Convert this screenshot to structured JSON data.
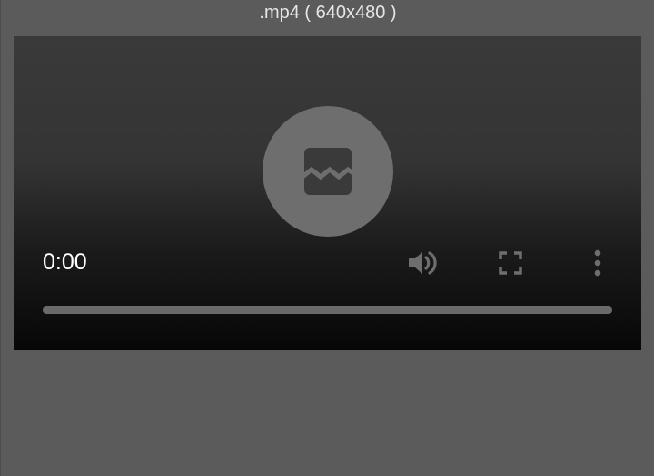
{
  "window": {
    "title": ".mp4 ( 640x480 )"
  },
  "player": {
    "current_time": "0:00",
    "progress_fraction": 0,
    "center_icon": "broken-image-icon",
    "controls": {
      "volume_icon": "volume-icon",
      "fullscreen_icon": "fullscreen-icon",
      "more_icon": "more-vertical-icon"
    }
  },
  "colors": {
    "page_background": "#5b5b5b",
    "icon_gray": "#6e6e6e",
    "icon_dark": "#3a3a3a",
    "text_white": "#ffffff"
  }
}
